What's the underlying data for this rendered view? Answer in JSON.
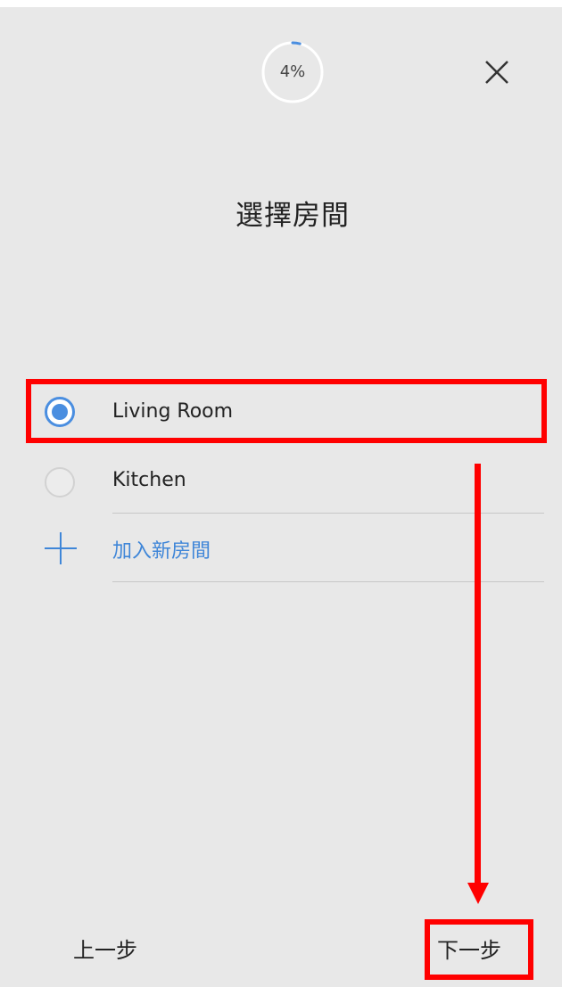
{
  "header": {
    "progress_text": "4%",
    "progress_fraction": 0.04,
    "close_icon": "close-icon"
  },
  "title": "選擇房間",
  "rooms": [
    {
      "label": "Living Room",
      "selected": true
    },
    {
      "label": "Kitchen",
      "selected": false
    }
  ],
  "add_room": {
    "label": "加入新房間",
    "icon": "plus-icon"
  },
  "footer": {
    "back_label": "上一步",
    "next_label": "下一步"
  },
  "colors": {
    "accent": "#4a8ee0",
    "link": "#3f86d8",
    "background": "#e8e8e8",
    "annotation": "#ff0000"
  }
}
